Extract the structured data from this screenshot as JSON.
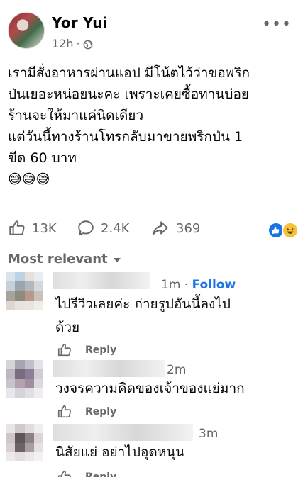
{
  "post": {
    "author": "Yor Yui",
    "time": "12h",
    "dot": "·",
    "more": "•••",
    "text_lines": [
      "เรามีสั่งอาหารผ่านแอป มีโน้ตไว้ว่าขอพริก",
      "ป่นเยอะหน่อยนะคะ เพราะเคยซื้อทานบ่อย",
      "ร้านจะให้มาแค่นิดเดียว",
      "แต่วันนี้ทางร้านโทรกลับมาขายพริกป่น 1",
      "ขีด 60 บาท",
      "😅😅😅"
    ]
  },
  "stats": {
    "likes": "13K",
    "comments": "2.4K",
    "shares": "369"
  },
  "comments_header": {
    "label": "Most relevant"
  },
  "comments": [
    {
      "time": "1m",
      "dot": "·",
      "follow": "Follow",
      "text_lines": [
        "ไปรีวิวเลยค่ะ ถ่ายรูปอันนี้ลงไป",
        "ด้วย"
      ],
      "reply": "Reply"
    },
    {
      "time": "2m",
      "text_lines": [
        "วงจรความคิดของเจ้าของแย่มาก"
      ],
      "reply": "Reply"
    },
    {
      "time": "3m",
      "text_lines": [
        "นิสัยแย่ อย่าไปอุดหนุน"
      ],
      "reply": "Reply"
    }
  ],
  "colors": {
    "accent": "#1b74e4",
    "muted": "#65676b",
    "text": "#050505"
  },
  "icons": [
    "globe-icon",
    "more-icon",
    "like-icon",
    "comment-icon",
    "share-icon",
    "like-reaction-icon",
    "haha-reaction-icon",
    "caret-down-icon"
  ]
}
